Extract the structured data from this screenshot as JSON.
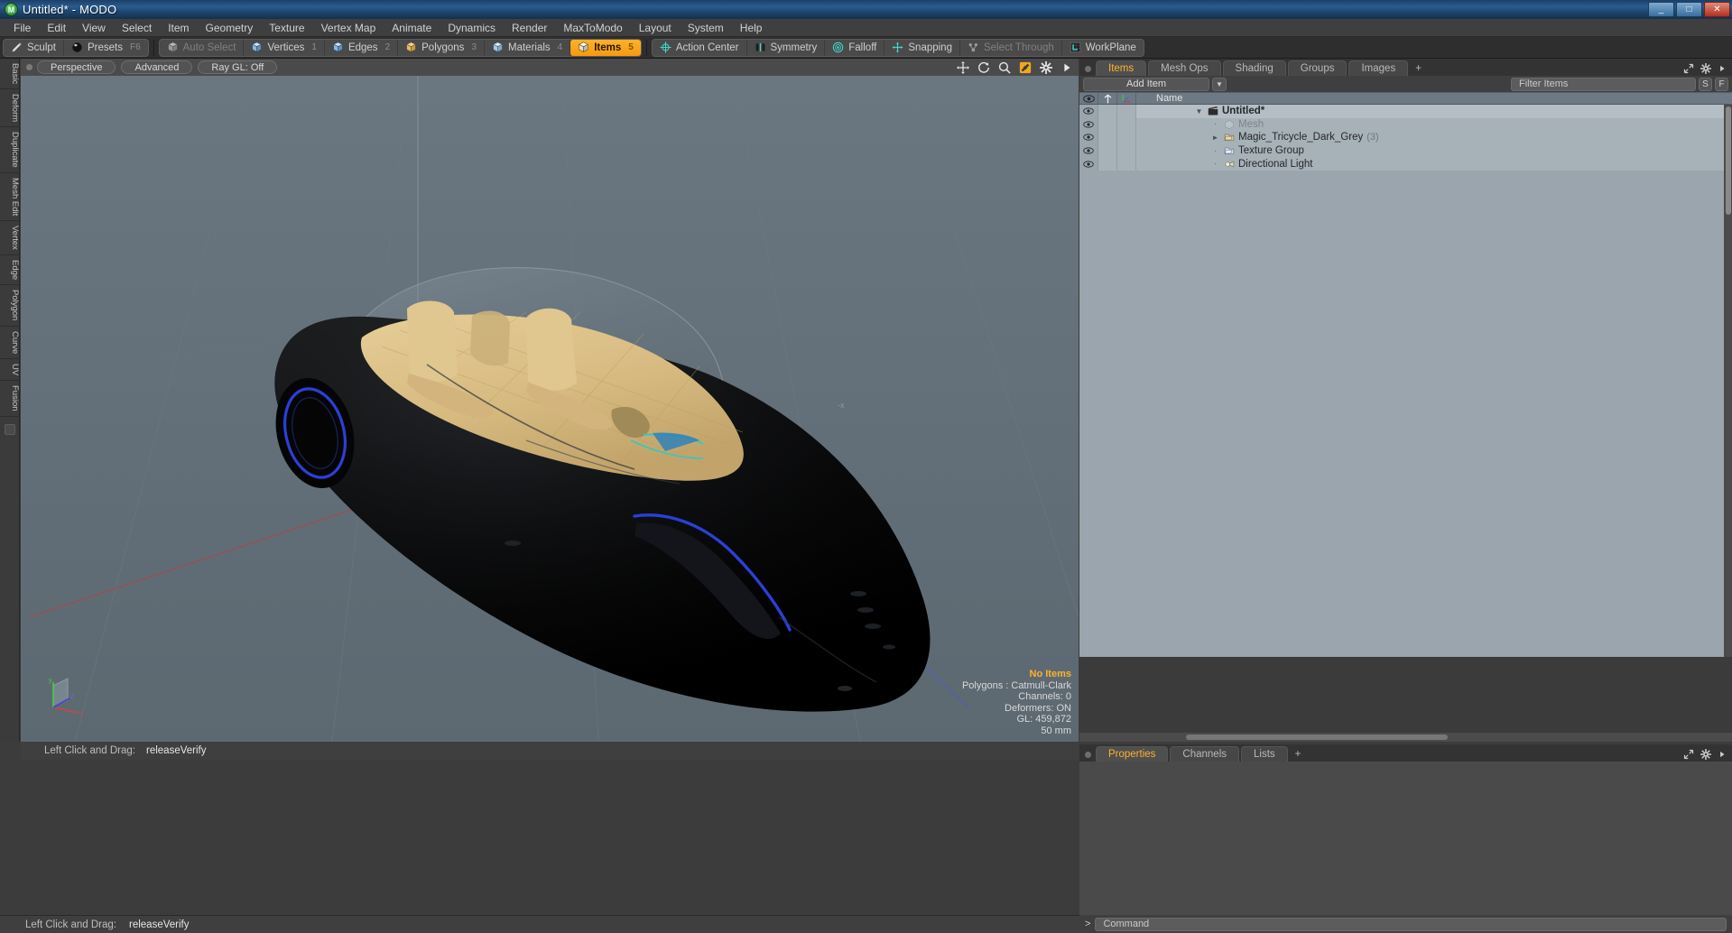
{
  "window": {
    "title": "Untitled* - MODO",
    "app_icon": "modo-logo-icon",
    "minimize": "_",
    "maximize": "□",
    "close": "✕"
  },
  "menubar": {
    "items": [
      "File",
      "Edit",
      "View",
      "Select",
      "Item",
      "Geometry",
      "Texture",
      "Vertex Map",
      "Animate",
      "Dynamics",
      "Render",
      "MaxToModo",
      "Layout",
      "System",
      "Help"
    ]
  },
  "modebar": {
    "group1": [
      {
        "label": "Sculpt",
        "icon": "brush-icon",
        "state": "normal",
        "shortcut": ""
      },
      {
        "label": "Presets",
        "icon": "sphere-icon",
        "state": "normal",
        "shortcut": "F6"
      }
    ],
    "group2": [
      {
        "label": "Auto Select",
        "icon": "cube-grey-icon",
        "state": "disabled",
        "shortcut": ""
      },
      {
        "label": "Vertices",
        "icon": "cube-vertex-icon",
        "state": "normal",
        "shortcut": "1"
      },
      {
        "label": "Edges",
        "icon": "cube-edge-icon",
        "state": "normal",
        "shortcut": "2"
      },
      {
        "label": "Polygons",
        "icon": "cube-poly-icon",
        "state": "normal",
        "shortcut": "3"
      },
      {
        "label": "Materials",
        "icon": "cube-material-icon",
        "state": "normal",
        "shortcut": "4"
      },
      {
        "label": "Items",
        "icon": "cube-items-icon",
        "state": "active",
        "shortcut": "5"
      }
    ],
    "group3": [
      {
        "label": "Action Center",
        "icon": "action-center-icon",
        "state": "normal",
        "shortcut": ""
      },
      {
        "label": "Symmetry",
        "icon": "symmetry-icon",
        "state": "normal",
        "shortcut": ""
      },
      {
        "label": "Falloff",
        "icon": "falloff-icon",
        "state": "normal",
        "shortcut": ""
      },
      {
        "label": "Snapping",
        "icon": "snapping-icon",
        "state": "normal",
        "shortcut": ""
      },
      {
        "label": "Select Through",
        "icon": "select-through-icon",
        "state": "disabled",
        "shortcut": ""
      },
      {
        "label": "WorkPlane",
        "icon": "workplane-icon",
        "state": "normal",
        "shortcut": ""
      }
    ]
  },
  "left_rail": {
    "tabs": [
      "Basic",
      "Deform",
      "Duplicate",
      "Mesh Edit",
      "Vertex",
      "Edge",
      "Polygon",
      "Curve",
      "UV",
      "Fusion"
    ]
  },
  "viewport": {
    "header": {
      "view_mode": "Perspective",
      "shading": "Advanced",
      "raygl": "Ray GL: Off",
      "icons": [
        "move-icon",
        "rotate-icon",
        "zoom-icon",
        "fit-icon",
        "gear-icon",
        "chevron-right-icon"
      ]
    },
    "stats": {
      "no_items": "No Items",
      "polygons": "Polygons : Catmull-Clark",
      "channels": "Channels: 0",
      "deformers": "Deformers: ON",
      "gl": "GL: 459,872",
      "scale": "50 mm"
    },
    "axis_gizmo": {
      "x": "x",
      "y": "y",
      "z": "z"
    },
    "background_color": "#63707a",
    "model_name": "Magic Tricycle (dark grey car body with tan interior and blue trim)"
  },
  "right_dock": {
    "tabs": [
      {
        "label": "Items",
        "selected": true
      },
      {
        "label": "Mesh Ops",
        "selected": false
      },
      {
        "label": "Shading",
        "selected": false
      },
      {
        "label": "Groups",
        "selected": false
      },
      {
        "label": "Images",
        "selected": false
      },
      {
        "label": "+",
        "selected": false
      }
    ],
    "toolbar": {
      "add_item": "Add Item",
      "add_item_dropdown": "chevron-down-icon",
      "filter_placeholder": "Filter Items",
      "filter_value": "",
      "btn_s": "S",
      "btn_f": "F"
    },
    "columns": {
      "eye": "eye-icon",
      "lock": "lock-icon",
      "xyz": "axis-icon",
      "name": "Name"
    },
    "items": [
      {
        "name": "Untitled*",
        "icon": "scene-icon",
        "indent": 0,
        "twisty": "open",
        "count": "",
        "dim": false,
        "bold": true
      },
      {
        "name": "Mesh",
        "icon": "mesh-icon",
        "indent": 1,
        "twisty": "none",
        "count": "",
        "dim": true,
        "bold": false
      },
      {
        "name": "Magic_Tricycle_Dark_Grey",
        "icon": "mesh-layer-icon",
        "indent": 1,
        "twisty": "closed",
        "count": "(3)",
        "dim": false,
        "bold": false
      },
      {
        "name": "Texture Group",
        "icon": "texture-group-icon",
        "indent": 1,
        "twisty": "none",
        "count": "",
        "dim": false,
        "bold": false
      },
      {
        "name": "Directional Light",
        "icon": "light-icon",
        "indent": 1,
        "twisty": "none",
        "count": "",
        "dim": false,
        "bold": false
      }
    ]
  },
  "properties_panel": {
    "tabs": [
      {
        "label": "Properties",
        "selected": true
      },
      {
        "label": "Channels",
        "selected": false
      },
      {
        "label": "Lists",
        "selected": false
      },
      {
        "label": "+",
        "selected": false
      }
    ]
  },
  "status": {
    "hint_label": "Left Click and Drag:",
    "hint_value": "releaseVerify"
  },
  "command": {
    "caret": ">",
    "placeholder": "Command",
    "value": ""
  },
  "colors": {
    "accent_orange": "#ffb22a",
    "viewport_bg": "#63707a",
    "panel_bg": "#3b3b3b",
    "tree_bg": "#a7b1b8",
    "title_blue": "#2a5c8f"
  }
}
